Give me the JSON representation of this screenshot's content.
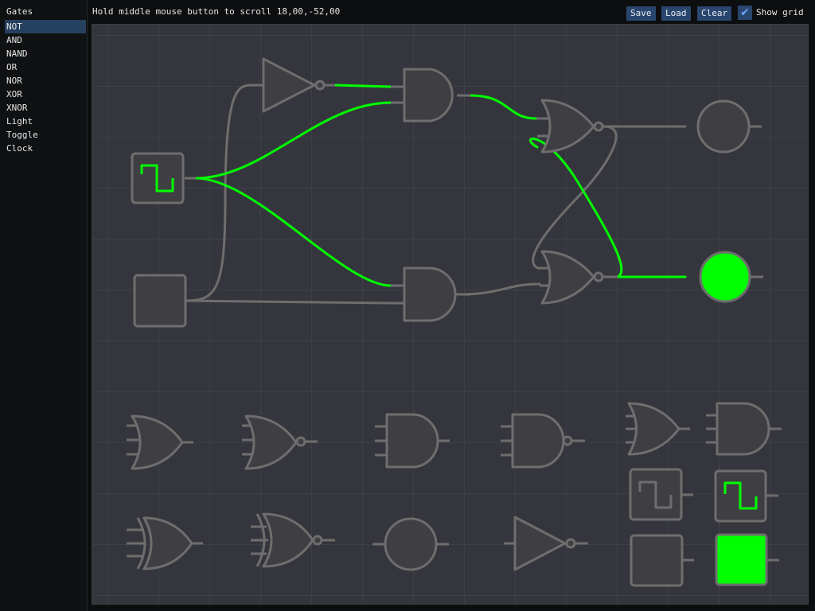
{
  "sidebar": {
    "title": "Gates",
    "items": [
      {
        "label": "NOT",
        "selected": true
      },
      {
        "label": "AND",
        "selected": false
      },
      {
        "label": "NAND",
        "selected": false
      },
      {
        "label": "OR",
        "selected": false
      },
      {
        "label": "NOR",
        "selected": false
      },
      {
        "label": "XOR",
        "selected": false
      },
      {
        "label": "XNOR",
        "selected": false
      },
      {
        "label": "Light",
        "selected": false
      },
      {
        "label": "Toggle",
        "selected": false
      },
      {
        "label": "Clock",
        "selected": false
      }
    ]
  },
  "toolbar": {
    "hint": "Hold middle mouse button to scroll 18,00,-52,00",
    "save_label": "Save",
    "load_label": "Load",
    "clear_label": "Clear",
    "show_grid_label": "Show grid",
    "show_grid_checked": true
  },
  "colors": {
    "accent_active": "#00ff00",
    "wire_inactive": "#6e6e6e",
    "gate_fill": "#3f3f43",
    "gate_stroke": "#6e6e6e",
    "canvas_bg": "#35363d",
    "grid_line": "#42444c",
    "button_bg": "#29466e",
    "selected_bg": "#26405f"
  },
  "circuit": {
    "gates": [
      {
        "id": "clock-1",
        "type": "Clock",
        "active": true
      },
      {
        "id": "toggle-1",
        "type": "Toggle",
        "active": false
      },
      {
        "id": "not-1",
        "type": "NOT",
        "active": true
      },
      {
        "id": "and-1",
        "type": "AND",
        "active": false
      },
      {
        "id": "and-2",
        "type": "AND",
        "active": false
      },
      {
        "id": "nor-1",
        "type": "NOR",
        "active": false
      },
      {
        "id": "nor-2",
        "type": "NOR",
        "active": true
      },
      {
        "id": "light-1",
        "type": "Light",
        "active": false
      },
      {
        "id": "light-2",
        "type": "Light",
        "active": true
      }
    ],
    "palette": [
      "OR",
      "NOR",
      "AND",
      "NAND",
      "OR",
      "AND",
      "XOR",
      "XNOR",
      "Light",
      "NOT",
      "Clock",
      "Clock",
      "Toggle",
      "Toggle"
    ]
  }
}
